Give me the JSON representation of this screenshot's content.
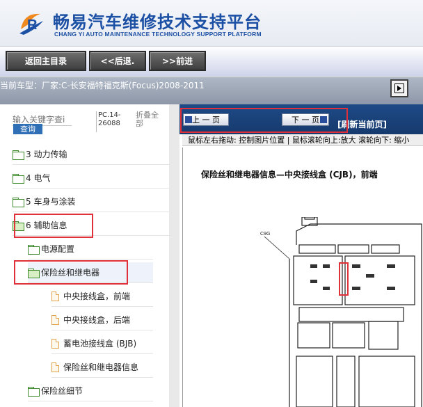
{
  "header": {
    "title": "畅易汽车维修技术支持平台",
    "subtitle": "CHANG YI AUTO MAINTENANCE TECHNOLOGY SUPPORT PLATFORM",
    "logo_letter": "R"
  },
  "nav": {
    "home": "返回主目录",
    "back": "<<后退.",
    "forward": ">>前进"
  },
  "model": {
    "label": "当前车型：",
    "value": "厂家:C-长安福特福克斯(Focus)2008-2011"
  },
  "sidebar": {
    "search_placeholder": "输入关键字查i",
    "search_button": "查询",
    "code": "PC.14-26088",
    "collapse": "折叠全部",
    "items": [
      {
        "label": "3 动力传输"
      },
      {
        "label": "4 电气"
      },
      {
        "label": "5 车身与涂装"
      },
      {
        "label": "6 辅助信息"
      },
      {
        "label": "电源配置"
      },
      {
        "label": "保险丝和继电器"
      },
      {
        "label": "中央接线盒，前端"
      },
      {
        "label": "中央接线盒，后端"
      },
      {
        "label": "蓄电池接线盒 (BJB)"
      },
      {
        "label": "保险丝和继电器信息"
      },
      {
        "label": "保险丝细节"
      }
    ]
  },
  "viewer": {
    "prev": "上 一 页",
    "next": "下 一 页",
    "refresh": "[刷新当前页]",
    "hint": "鼠标左右拖动: 控制图片位置 | 鼠标滚轮向上:放大  滚轮向下: 缩小",
    "title": "保险丝和继电器信息—中央接线盒 (CJB)，前端",
    "diagram_label": "C9G"
  },
  "colors": {
    "brand_blue": "#1c50a4",
    "toolbar_dark": "#163a6d",
    "highlight_red": "#e0303a",
    "folder_green": "#3a8a2a"
  }
}
